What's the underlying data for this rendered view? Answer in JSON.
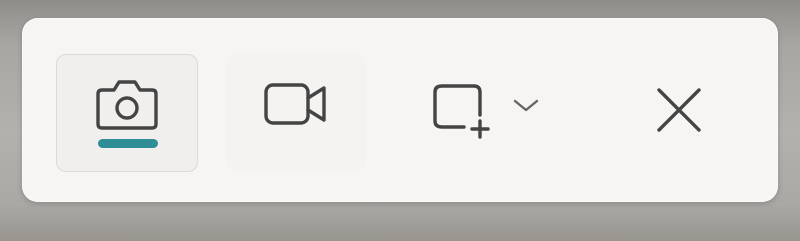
{
  "toolbar": {
    "modes": [
      {
        "icon": "camera-icon",
        "selected": true
      },
      {
        "icon": "video-camera-icon",
        "selected": false
      }
    ],
    "capture_area": {
      "icon": "rectangle-region-icon",
      "dropdown_icon": "chevron-down-icon"
    },
    "close": {
      "icon": "close-icon"
    }
  },
  "colors": {
    "accent": "#2f8e95",
    "icon": "#444444",
    "toolbar_background": "#f6f5f3"
  }
}
